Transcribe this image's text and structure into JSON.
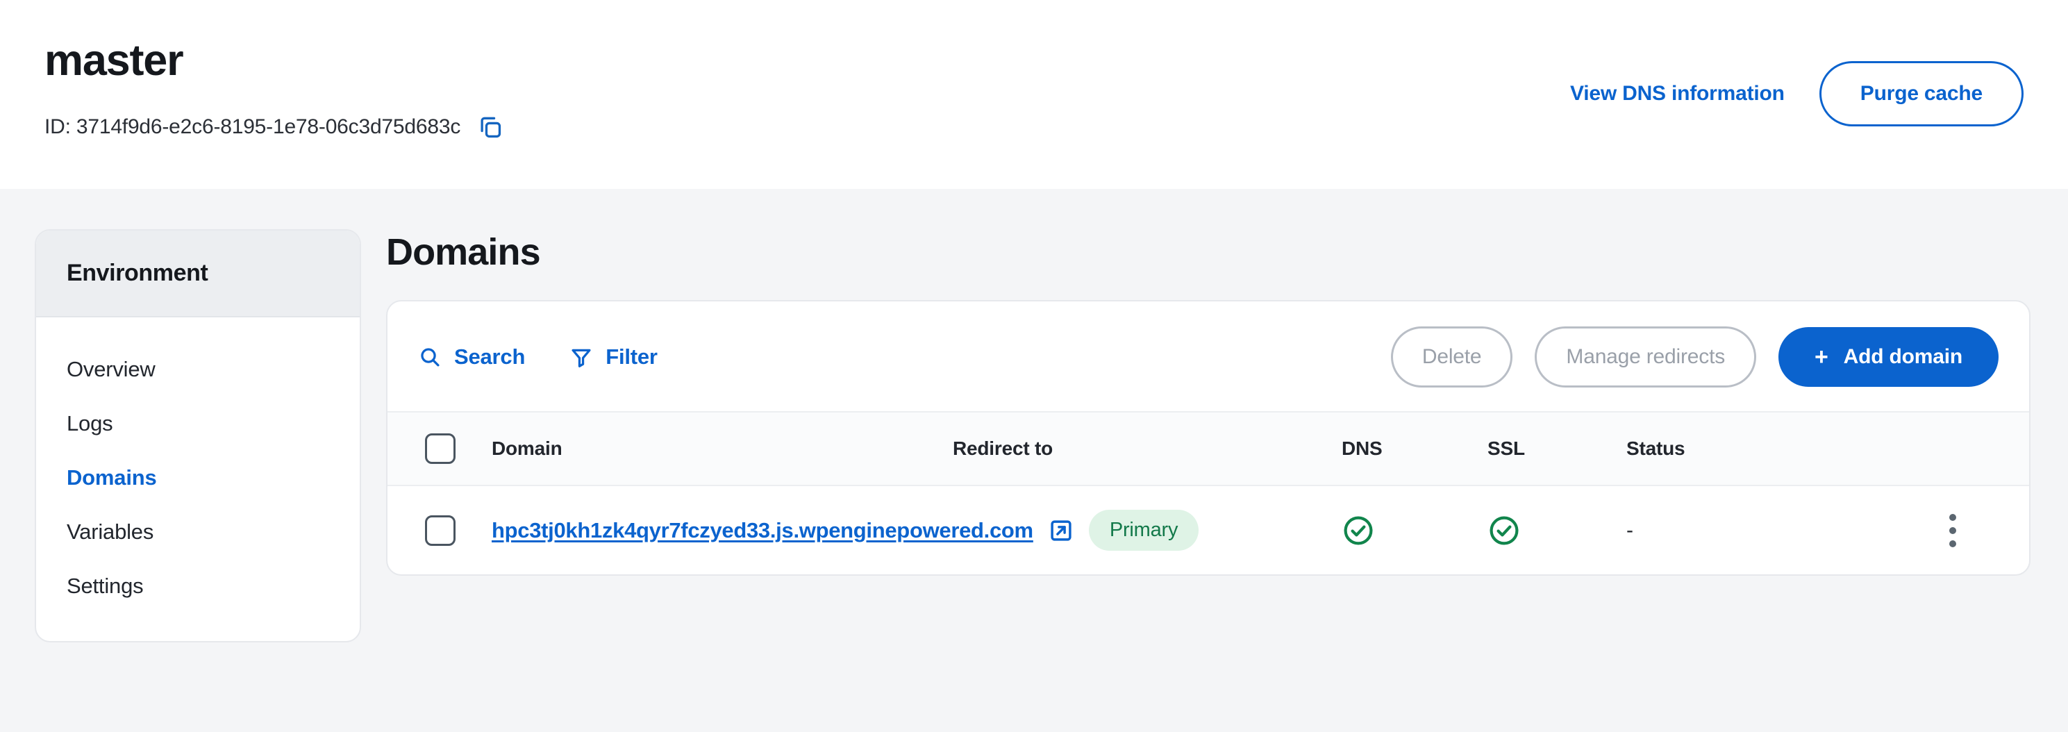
{
  "header": {
    "environment_title": "master",
    "environment_id_label": "ID: 3714f9d6-e2c6-8195-1e78-06c3d75d683c",
    "copy_icon": "copy-icon",
    "dns_link_label": "View DNS information",
    "purge_cache_label": "Purge cache",
    "link_color": "#0b63ce"
  },
  "sidebar": {
    "section_title": "Environment",
    "items": [
      {
        "label": "Overview",
        "active": false
      },
      {
        "label": "Logs",
        "active": false
      },
      {
        "label": "Domains",
        "active": true
      },
      {
        "label": "Variables",
        "active": false
      },
      {
        "label": "Settings",
        "active": false
      }
    ]
  },
  "main": {
    "page_title": "Domains",
    "toolbar": {
      "search_label": "Search",
      "search_icon": "search-icon",
      "filter_label": "Filter",
      "filter_icon": "filter-icon",
      "delete_label": "Delete",
      "manage_redirects_label": "Manage redirects",
      "add_domain_label": "Add domain",
      "add_domain_plus": "+",
      "primary_button_color": "#0b63ce",
      "disabled_text_color": "#9aa0a9"
    },
    "table": {
      "columns": [
        "Domain",
        "Redirect to",
        "DNS",
        "SSL",
        "Status"
      ],
      "rows": [
        {
          "selected": false,
          "domain": "hpc3tj0kh1zk4qyr7fczyed33.js.wpenginepowered.com",
          "external_link_icon": "external-link-icon",
          "badge": "Primary",
          "badge_bg": "#dff3e6",
          "badge_color": "#13794a",
          "redirect_to": "",
          "dns_status_icon": "check-circle-icon",
          "ssl_status_icon": "check-circle-icon",
          "status_icon_color": "#11854c",
          "status": "-",
          "menu_icon": "kebab-menu-icon"
        }
      ]
    }
  }
}
